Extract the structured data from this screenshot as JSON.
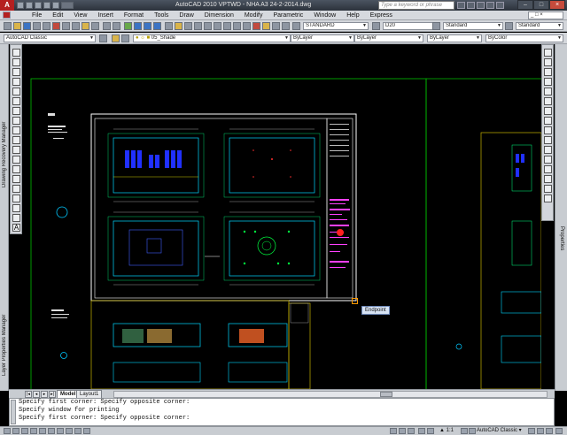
{
  "window": {
    "title": "AutoCAD 2010     VPTWD - NHA A3 24-2-2014.dwg",
    "search_placeholder": "Type a keyword or phrase",
    "logo": "A"
  },
  "menu": {
    "items": [
      "File",
      "Edit",
      "View",
      "Insert",
      "Format",
      "Tools",
      "Draw",
      "Dimension",
      "Modify",
      "Parametric",
      "Window",
      "Help",
      "Express"
    ]
  },
  "styles": {
    "text_style": "STANDARD",
    "dim_style": "D20",
    "table_style": "Standard",
    "multileader_style": "Standard"
  },
  "layers": {
    "workspace": "AutoCAD Classic",
    "current_layer": "05_Shade",
    "color": "ByLayer",
    "linetype": "ByLayer",
    "lineweight": "ByLayer",
    "plotstyle": "ByColor"
  },
  "palettes": {
    "left_top": "Drawing Recovery Manager",
    "left_bottom": "Layer Properties Manager",
    "right": "Properties"
  },
  "canvas": {
    "tooltip": "Endpoint"
  },
  "layout_tabs": [
    "Model",
    "Layout1"
  ],
  "command_line": [
    "Specify first corner: Specify opposite corner:",
    "Specify window for printing",
    "Specify first corner: Specify opposite corner:"
  ],
  "status": {
    "annotation_scale": "1:1",
    "workspace": "AutoCAD Classic"
  },
  "colors": {
    "canvas_bg": "#000000",
    "frame": "#ffffff",
    "cyan": "#00ffff",
    "green": "#00ff00",
    "magenta": "#ff00ff",
    "yellow": "#c8b400",
    "accent": "#b52020"
  }
}
